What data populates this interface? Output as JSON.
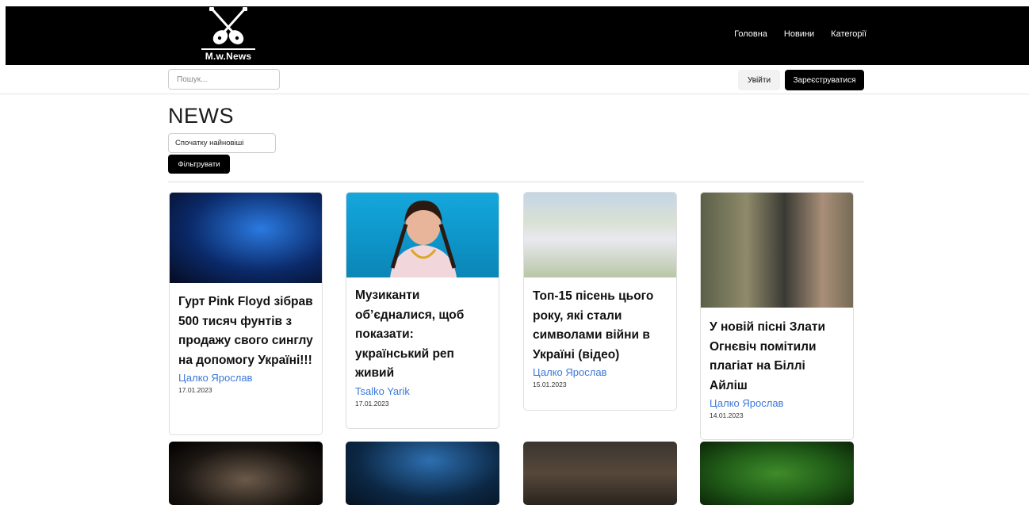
{
  "brand": {
    "name": "M.w.News"
  },
  "nav": {
    "items": [
      "Головна",
      "Новини",
      "Категорії"
    ]
  },
  "search": {
    "placeholder": "Пошук..."
  },
  "auth": {
    "login_label": "Увійти",
    "register_label": "Зареєструватися"
  },
  "page": {
    "title": "NEWS",
    "sort_selected": "Спочатку найновіші",
    "filter_label": "Фільтрувати"
  },
  "cards": [
    {
      "title": "Гурт Pink Floyd зібрав 500 тисяч фунтів з продажу свого синглу на допомогу Україні!!!",
      "author": "Цалко Ярослав",
      "date": "17.01.2023"
    },
    {
      "title": "Музиканти об’єдналися, щоб показати: український реп живий",
      "author": "Tsalko Yarik",
      "date": "17.01.2023"
    },
    {
      "title": "Топ-15 пісень цього року, які стали символами війни в Україні (відео)",
      "author": "Цалко Ярослав",
      "date": "15.01.2023"
    },
    {
      "title": "У новій пісні Злати Огнєвіч помітили плагіат на Біллі Айліш",
      "author": "Цалко Ярослав",
      "date": "14.01.2023"
    }
  ],
  "colors": {
    "header_bg": "#000000",
    "author_link": "#3c78d8",
    "button_dark": "#000000"
  }
}
